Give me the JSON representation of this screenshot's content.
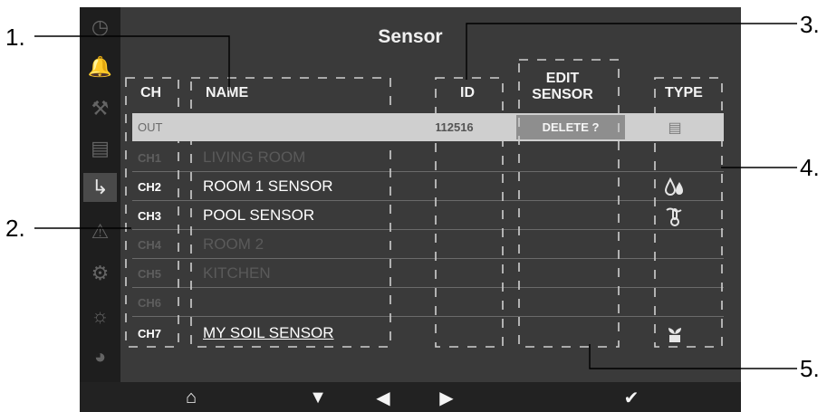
{
  "screen_title": "Sensor",
  "headers": {
    "ch": "CH",
    "name": "NAME",
    "id": "ID",
    "edit_line1": "EDIT",
    "edit_line2": "SENSOR",
    "type": "TYPE"
  },
  "rows": [
    {
      "ch": "OUT",
      "name": "",
      "id": "112516",
      "edit": "DELETE ?",
      "type_icon": "outdoor-sensor-icon",
      "selected": true
    },
    {
      "ch": "CH1",
      "name": "LIVING ROOM",
      "id": "",
      "edit": "",
      "type_icon": "",
      "dimmed": true
    },
    {
      "ch": "CH2",
      "name": "ROOM 1 SENSOR",
      "id": "",
      "edit": "",
      "type_icon": "humidity-drops-icon"
    },
    {
      "ch": "CH3",
      "name": "POOL SENSOR",
      "id": "",
      "edit": "",
      "type_icon": "pool-thermometer-icon"
    },
    {
      "ch": "CH4",
      "name": "ROOM 2",
      "id": "",
      "edit": "",
      "type_icon": "",
      "dimmed": true
    },
    {
      "ch": "CH5",
      "name": "KITCHEN",
      "id": "",
      "edit": "",
      "type_icon": "",
      "dimmed": true
    },
    {
      "ch": "CH6",
      "name": "",
      "id": "",
      "edit": "",
      "type_icon": "",
      "dimmed": true
    },
    {
      "ch": "CH7",
      "name": "MY SOIL SENSOR",
      "id": "",
      "edit": "",
      "type_icon": "soil-plant-icon"
    }
  ],
  "sidebar": {
    "items": [
      {
        "icon": "clock-icon"
      },
      {
        "icon": "bell-icon"
      },
      {
        "icon": "tools-icon"
      },
      {
        "icon": "ruler-icon"
      },
      {
        "icon": "sensor-icon",
        "active": true
      },
      {
        "icon": "warning-icon"
      },
      {
        "icon": "temperature-settings-icon"
      },
      {
        "icon": "people-settings-icon"
      },
      {
        "icon": "pie-chart-icon"
      }
    ]
  },
  "bottom_bar": {
    "buttons": [
      "home-icon",
      "down-arrow-icon",
      "left-arrow-icon",
      "right-arrow-icon",
      "check-icon"
    ]
  },
  "callouts": {
    "c1": "1.",
    "c2": "2.",
    "c3": "3.",
    "c4": "4.",
    "c5": "5."
  },
  "colors": {
    "screen_bg": "#3a3a3a",
    "sidebar_bg": "#1e1e1e",
    "selected_row": "#cfcfcf",
    "edit_button": "#8e8e8e"
  }
}
